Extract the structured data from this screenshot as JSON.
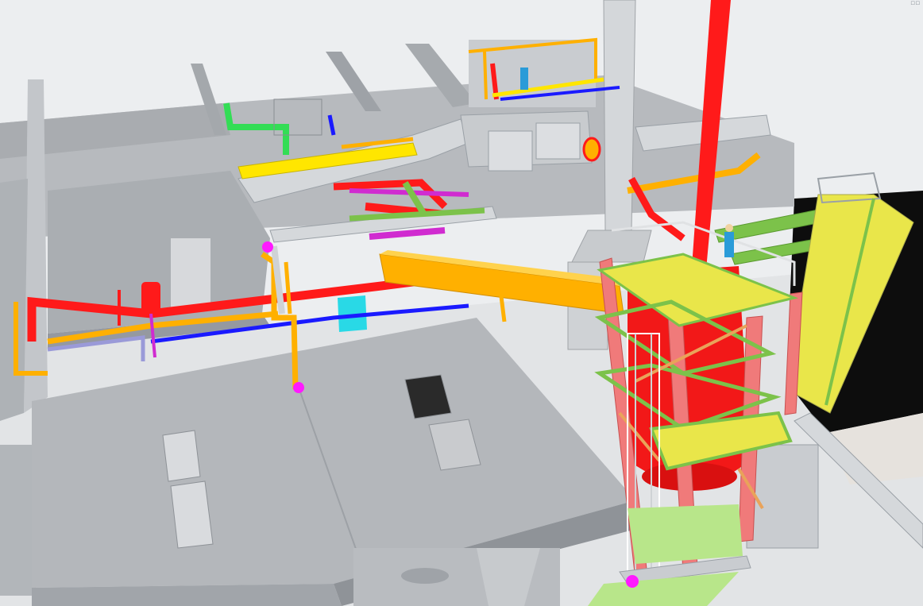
{
  "viewport": {
    "kind": "3d-plant-model-view",
    "background": "#e9ecef"
  },
  "palette": {
    "concrete": "#b9bcc0",
    "concrete_top": "#c9ccd0",
    "concrete_dark": "#9ea2a7",
    "floor_light": "#dde0e3",
    "pipe_red": "#ff1a1a",
    "pipe_orange": "#ffb000",
    "pipe_yellow": "#ffe600",
    "pipe_blue": "#1a1aff",
    "pipe_green": "#33dd55",
    "pipe_magenta": "#d02bd0",
    "pipe_cyan": "#29d9e6",
    "steel_pink": "#f07a7a",
    "steel_green": "#7cc24a",
    "grating_yellow": "#e9e64a",
    "duct_grey": "#d5d8db",
    "vessel_red": "#f21818",
    "black_floor": "#0d0d0d",
    "support_green": "#b8e68a",
    "marker_magenta": "#ff1aff",
    "worker_blue": "#2a9bd8"
  },
  "markers": [
    {
      "name": "node-marker-1"
    },
    {
      "name": "node-marker-2"
    },
    {
      "name": "node-marker-3"
    }
  ],
  "icons": {
    "view_corner": "view-corner-icon"
  }
}
